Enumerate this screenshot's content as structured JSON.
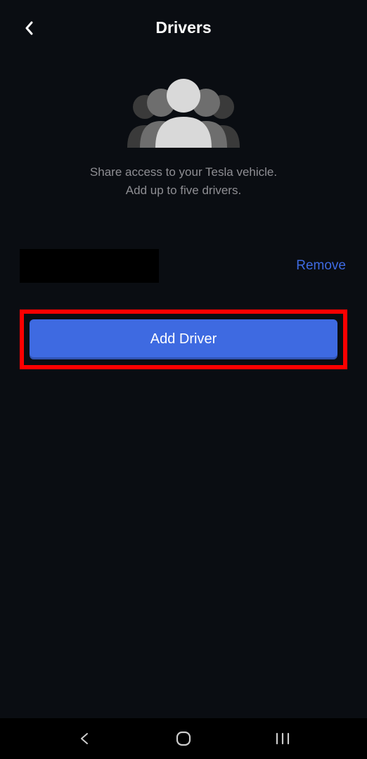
{
  "header": {
    "title": "Drivers"
  },
  "hero": {
    "info_line1": "Share access to your Tesla vehicle.",
    "info_line2": "Add up to five drivers."
  },
  "driver_row": {
    "remove_label": "Remove"
  },
  "add_button": {
    "label": "Add Driver"
  },
  "colors": {
    "accent": "#3e6ae1",
    "highlight_border": "#ff0000",
    "bg": "#0a0d12"
  }
}
